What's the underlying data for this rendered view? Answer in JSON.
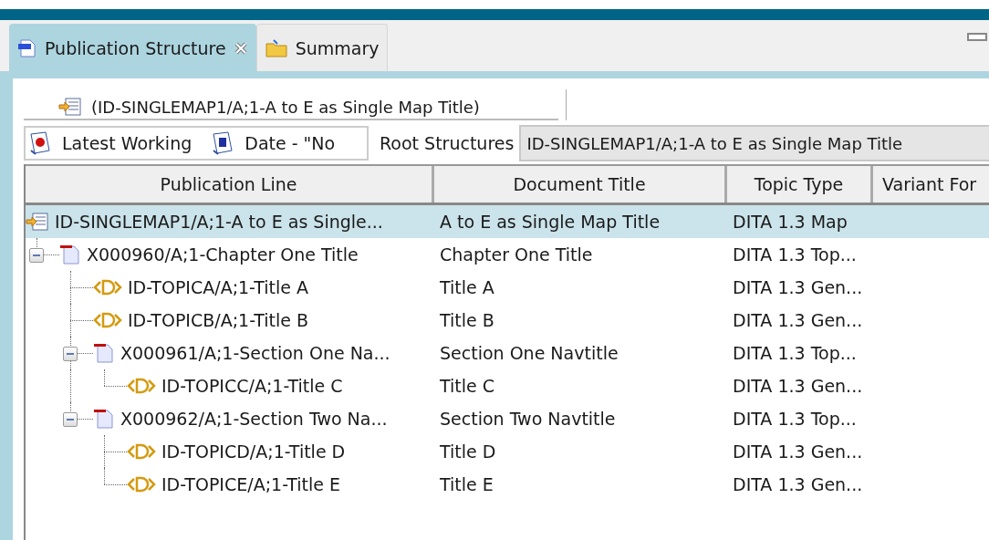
{
  "tabs": [
    {
      "label": "Publication Structure",
      "selected": true,
      "closable": true,
      "kind": "xml"
    },
    {
      "label": "Summary",
      "selected": false,
      "closable": false,
      "kind": "folder"
    }
  ],
  "breadcrumb": "(ID-SINGLEMAP1/A;1-A to E as Single Map Title)",
  "filters": [
    {
      "label": "Latest Working",
      "kind": "r"
    },
    {
      "label": "Date - \"No",
      "kind": "e"
    }
  ],
  "root_label": "Root Structures",
  "root_value": "ID-SINGLEMAP1/A;1-A to E as Single Map Title",
  "table": {
    "columns": [
      "Publication Line",
      "Document Title",
      "Topic Type",
      "Variant For"
    ],
    "rows": [
      {
        "kind": "map",
        "selected": true,
        "cells": [
          "ID-SINGLEMAP1/A;1-A to E as Single...",
          "A to E as Single Map Title",
          "DITA 1.3 Map"
        ],
        "children": [
          {
            "kind": "chapter",
            "selected": false,
            "expanded": true,
            "cells": [
              "X000960/A;1-Chapter One Title",
              "Chapter One Title",
              "DITA 1.3 Top..."
            ],
            "children": [
              {
                "kind": "topic",
                "selected": false,
                "cells": [
                  "ID-TOPICA/A;1-Title A",
                  "Title A",
                  "DITA 1.3 Gen..."
                ]
              },
              {
                "kind": "topic",
                "selected": false,
                "cells": [
                  "ID-TOPICB/A;1-Title B",
                  "Title B",
                  "DITA 1.3 Gen..."
                ]
              },
              {
                "kind": "chapter",
                "selected": false,
                "expanded": true,
                "cells": [
                  "X000961/A;1-Section One Na...",
                  "Section One Navtitle",
                  "DITA 1.3 Top..."
                ],
                "children": [
                  {
                    "kind": "topic",
                    "selected": false,
                    "cells": [
                      "ID-TOPICC/A;1-Title C",
                      "Title C",
                      "DITA 1.3 Gen..."
                    ]
                  }
                ]
              },
              {
                "kind": "chapter",
                "selected": false,
                "expanded": true,
                "cells": [
                  "X000962/A;1-Section Two Na...",
                  "Section Two Navtitle",
                  "DITA 1.3 Top..."
                ],
                "children": [
                  {
                    "kind": "topic",
                    "selected": false,
                    "cells": [
                      "ID-TOPICD/A;1-Title D",
                      "Title D",
                      "DITA 1.3 Gen..."
                    ]
                  },
                  {
                    "kind": "topic",
                    "selected": false,
                    "cells": [
                      "ID-TOPICE/A;1-Title E",
                      "Title E",
                      "DITA 1.3 Gen..."
                    ]
                  }
                ]
              }
            ]
          }
        ]
      }
    ]
  }
}
